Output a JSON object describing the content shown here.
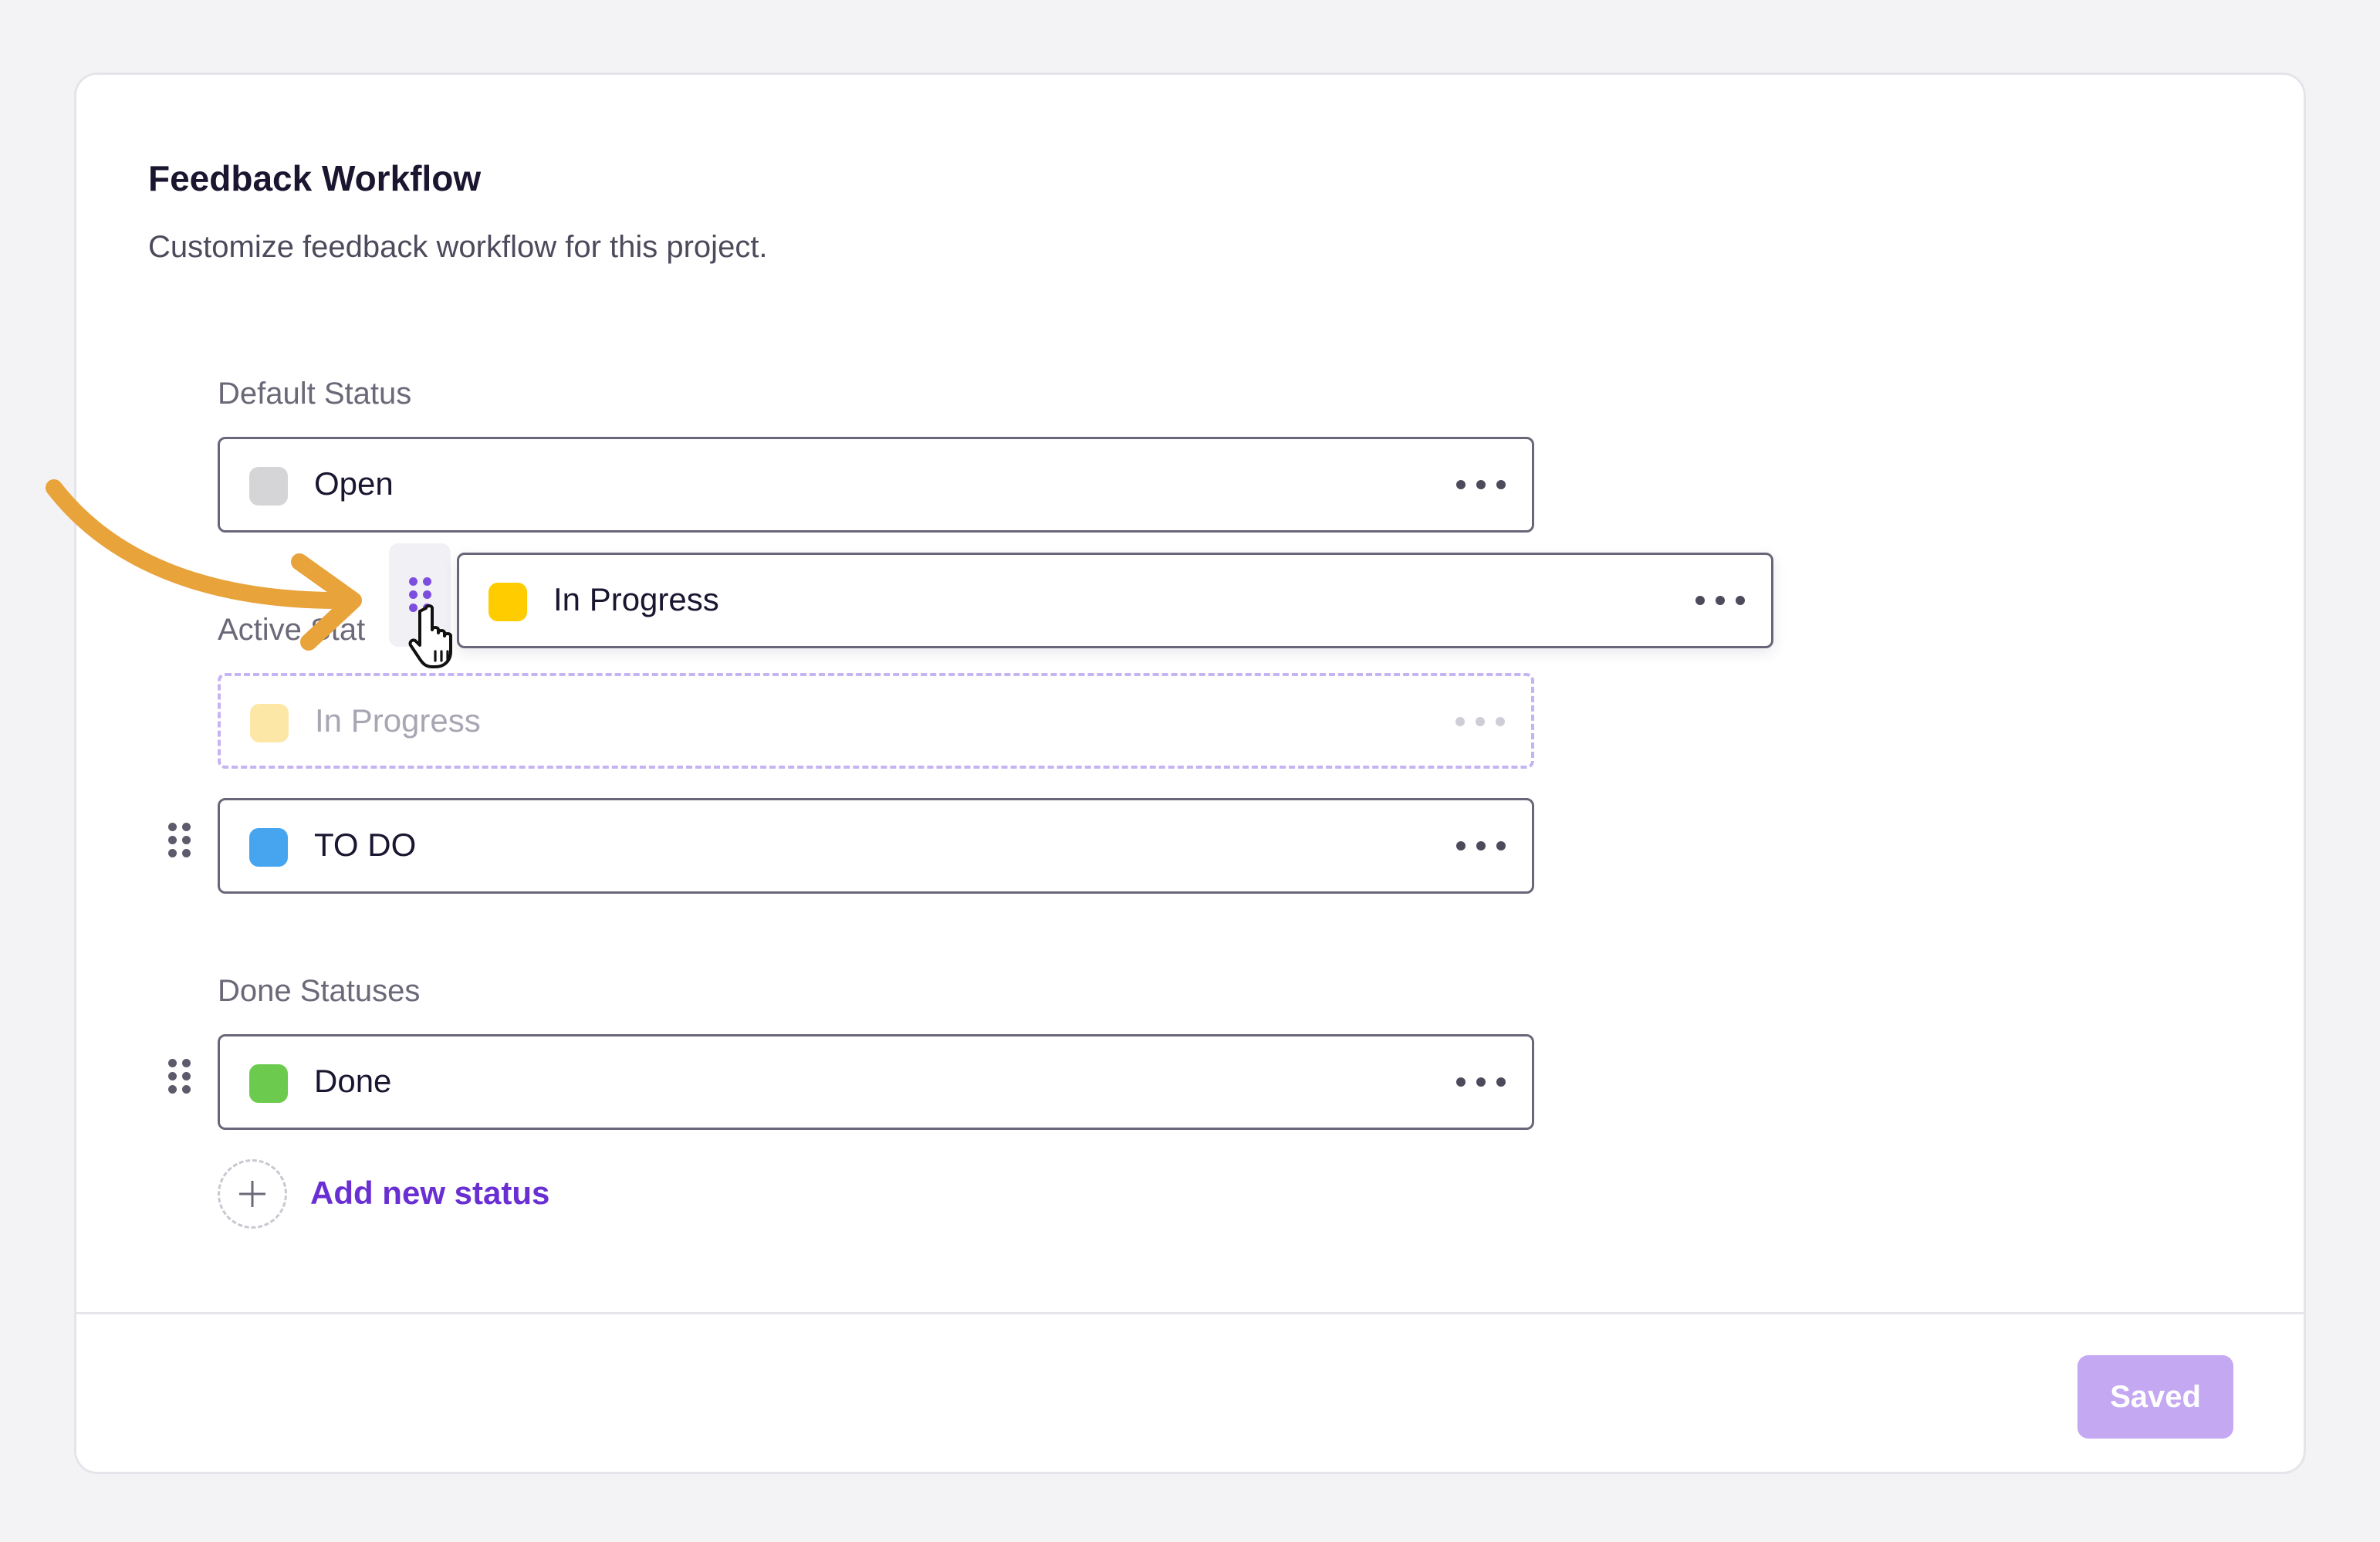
{
  "header": {
    "title": "Feedback Workflow",
    "subtitle": "Customize feedback workflow for this project."
  },
  "sections": {
    "default": {
      "label": "Default Status"
    },
    "active": {
      "label": "Active Stat"
    },
    "done": {
      "label": "Done Statuses"
    }
  },
  "statuses": {
    "open": {
      "label": "Open",
      "color": "#d5d5d8"
    },
    "in_progress": {
      "label": "In Progress",
      "color": "#ffcc00"
    },
    "in_progress_ghost": {
      "label": "In Progress",
      "color": "#fde7a7"
    },
    "todo": {
      "label": "TO DO",
      "color": "#47a5f0"
    },
    "done": {
      "label": "Done",
      "color": "#6ccb4f"
    }
  },
  "actions": {
    "add_status_label": "Add new status",
    "save_label": "Saved"
  },
  "colors": {
    "accent": "#6a2fd3",
    "save_disabled": "#c4a8f2",
    "annotation_arrow": "#e8a33a"
  },
  "icons": {
    "more": "more-horizontal-icon",
    "grip": "drag-handle-icon",
    "add": "plus-icon",
    "cursor": "hand-pointer-icon",
    "annotation": "curved-arrow-icon"
  }
}
